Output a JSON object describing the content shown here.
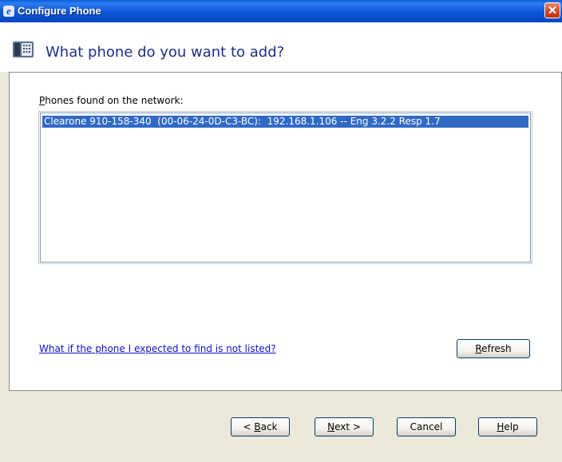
{
  "window": {
    "title": "Configure Phone",
    "close_label": "✕"
  },
  "header": {
    "heading": "What phone do you want to add?"
  },
  "phones": {
    "label_mnemonic": "P",
    "label_rest": "hones found on the network:",
    "items": [
      "Clearone 910-158-340  (00-06-24-0D-C3-BC):  192.168.1.106 -- Eng 3.2.2 Resp 1.7"
    ]
  },
  "help_link": "What if the phone I expected to find is not listed?",
  "buttons": {
    "refresh_mnemonic": "R",
    "refresh_rest": "efresh",
    "back_prefix": "< ",
    "back_mnemonic": "B",
    "back_rest": "ack",
    "next_mnemonic": "N",
    "next_rest": "ext >",
    "cancel": "Cancel",
    "help_mnemonic": "H",
    "help_rest": "elp"
  },
  "colors": {
    "selection": "#316ac5",
    "heading": "#1e2f8a",
    "link": "#1010c8"
  },
  "icons": [
    "browser-app-icon",
    "close-icon",
    "phone-icon"
  ]
}
